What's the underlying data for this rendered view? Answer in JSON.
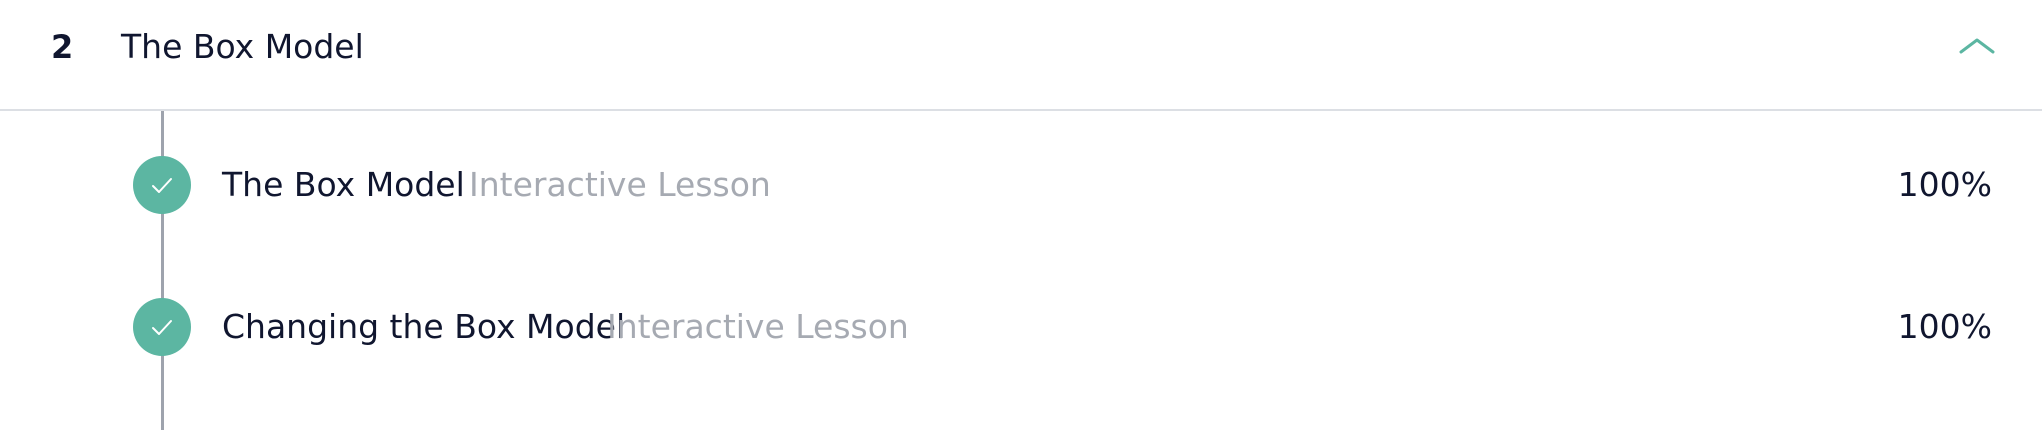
{
  "section": {
    "number": "2",
    "title": "The Box Model",
    "collapse_icon": "chevron-up-icon",
    "accent_color": "#5cb6a2"
  },
  "lessons": [
    {
      "title": "The Box Model",
      "type": "Interactive Lesson",
      "progress": "100%",
      "status_icon": "check-icon",
      "completed": true
    },
    {
      "title": "Changing the Box Model",
      "type": "Interactive Lesson",
      "progress": "100%",
      "status_icon": "check-icon",
      "completed": true
    }
  ],
  "colors": {
    "text_primary": "#10162f",
    "text_secondary": "#a6aab2",
    "divider": "#dcdfe4",
    "timeline": "#9ea3ad",
    "complete": "#5cb6a2"
  }
}
